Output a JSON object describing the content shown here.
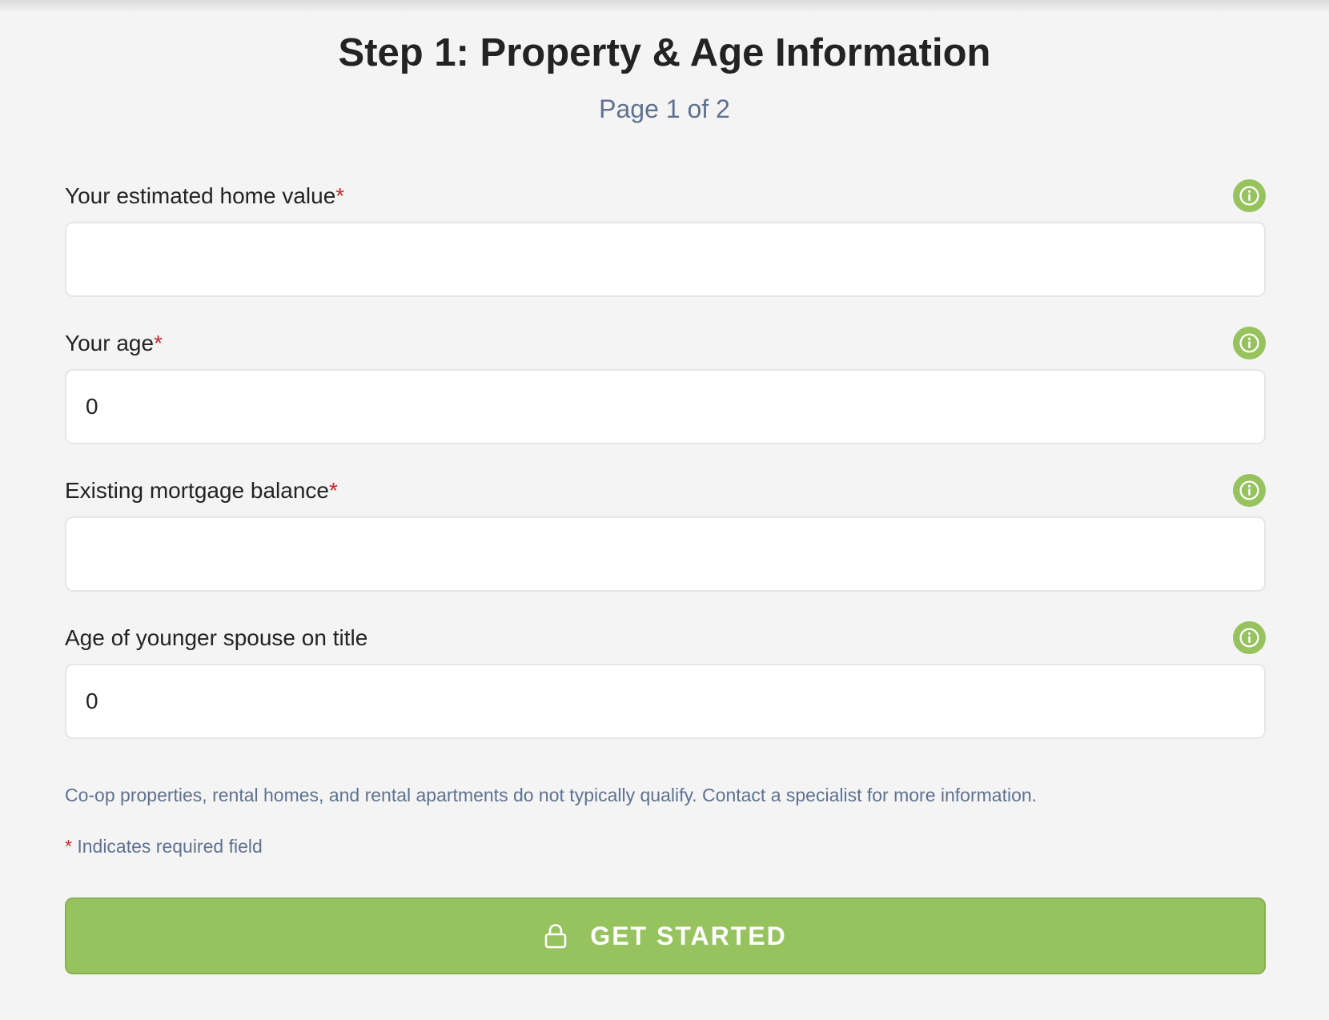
{
  "header": {
    "title": "Step 1: Property & Age Information",
    "subtitle": "Page 1 of 2"
  },
  "fields": [
    {
      "label": "Your estimated home value",
      "required_mark": "*",
      "value": "",
      "info_icon": "info-icon"
    },
    {
      "label": "Your age",
      "required_mark": "*",
      "value": "0",
      "info_icon": "info-icon"
    },
    {
      "label": "Existing mortgage balance",
      "required_mark": "*",
      "value": "",
      "info_icon": "info-icon"
    },
    {
      "label": "Age of younger spouse on title",
      "required_mark": "",
      "value": "0",
      "info_icon": "info-icon"
    }
  ],
  "note": "Co-op properties, rental homes, and rental apartments do not typically qualify. Contact a specialist for more information.",
  "required_note": {
    "mark": "*",
    "text": " Indicates required field"
  },
  "cta": {
    "label": "GET STARTED",
    "icon": "lock-icon"
  },
  "colors": {
    "accent": "#97c35e",
    "required": "#c62828",
    "muted_text": "#5f7290",
    "background": "#f4f4f4"
  }
}
